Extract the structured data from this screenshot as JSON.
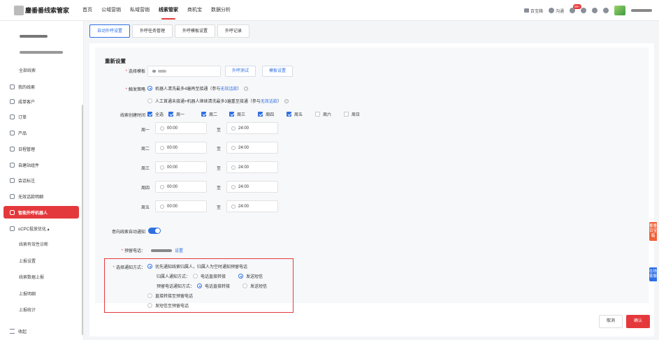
{
  "header": {
    "logo_text": "鏖番番线索管家",
    "nav": [
      "首页",
      "公域营销",
      "私域营销",
      "线索管家",
      "商机宝",
      "数据分析"
    ],
    "active_nav": "线索管家",
    "right": {
      "bao": "百宝箱",
      "talk": "沟通",
      "badge": "99+"
    }
  },
  "sidebar": {
    "items": [
      "全部线索",
      "我的线索",
      "成单客户",
      "订单",
      "产品",
      "日程管理",
      "自建站组件",
      "会话标注",
      "无效话款明细",
      "智能外呼机器人",
      "oCPC投放优化 ▴",
      "线索有效性诊断",
      "上报设置",
      "线索数据上报",
      "上报明细",
      "上报统计",
      "收起"
    ]
  },
  "tabs": [
    "自动外呼设置",
    "外呼任务管理",
    "外呼模板设置",
    "外呼记录"
  ],
  "form": {
    "section_title": "重新设置",
    "template_label": "选择模板",
    "test_button": "外呼测试",
    "template_button": "模板设置",
    "strategy_label": "触发策略",
    "strategy_option1": "机器人清洗最多4遍再至接通（参与",
    "strategy_option1_link": "无效话款",
    "strategy_option1_tail": "）",
    "strategy_option2": "人工首通未接通+机器人继续清洗最多3遍重至接通（参与",
    "strategy_option2_link": "无效话款",
    "strategy_option2_tail": "）",
    "time_label": "线索创建时间",
    "select_all": "全选",
    "weekdays": [
      "周一",
      "周二",
      "周三",
      "周四",
      "周五",
      "周六",
      "周日"
    ],
    "weekday_checked": [
      true,
      true,
      true,
      true,
      true,
      false,
      false
    ],
    "time_rows": [
      {
        "day": "周一",
        "start": "00:00",
        "end": "24:00"
      },
      {
        "day": "周二",
        "start": "00:00",
        "end": "24:00"
      },
      {
        "day": "周三",
        "start": "00:00",
        "end": "24:00"
      },
      {
        "day": "周四",
        "start": "00:00",
        "end": "24:00"
      },
      {
        "day": "周五",
        "start": "00:00",
        "end": "24:00"
      }
    ],
    "to_label": "至",
    "notify_label": "意向线索自动通知",
    "phone_label": "预留电话：",
    "phone_setting": "设置",
    "method_label": "选择通知方式：",
    "method_option1": "优先通知线索归属人，归属人为空时通知预留电话",
    "owner_method_label": "归属人通知方式：",
    "owner_opt_call": "电话直接转接",
    "owner_opt_sms": "发送短信",
    "reserved_method_label": "预留电话通知方式：",
    "reserved_opt_call": "电话直接转接",
    "reserved_opt_sms": "发送短信",
    "method_option2": "直接转接至预留电话",
    "method_option3": "发短信至预留电话"
  },
  "footer": {
    "cancel": "取消",
    "confirm": "确认"
  },
  "floats": {
    "orange": "番番百宝箱",
    "blue": "在线客服"
  }
}
